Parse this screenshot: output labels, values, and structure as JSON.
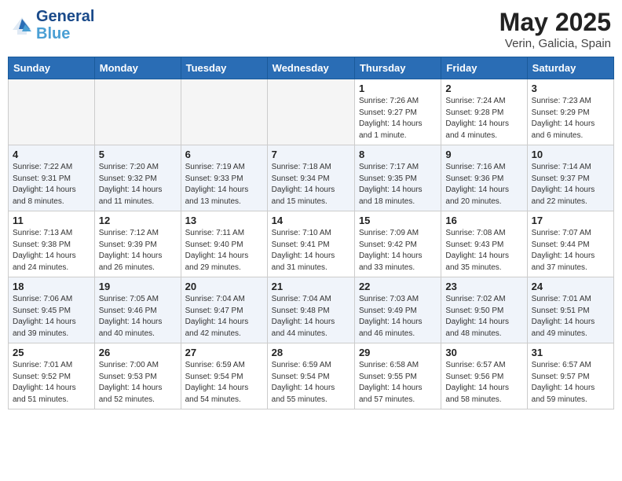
{
  "header": {
    "logo_line1": "General",
    "logo_line2": "Blue",
    "month_title": "May 2025",
    "location": "Verin, Galicia, Spain"
  },
  "days_of_week": [
    "Sunday",
    "Monday",
    "Tuesday",
    "Wednesday",
    "Thursday",
    "Friday",
    "Saturday"
  ],
  "weeks": [
    [
      {
        "num": "",
        "info": ""
      },
      {
        "num": "",
        "info": ""
      },
      {
        "num": "",
        "info": ""
      },
      {
        "num": "",
        "info": ""
      },
      {
        "num": "1",
        "info": "Sunrise: 7:26 AM\nSunset: 9:27 PM\nDaylight: 14 hours\nand 1 minute."
      },
      {
        "num": "2",
        "info": "Sunrise: 7:24 AM\nSunset: 9:28 PM\nDaylight: 14 hours\nand 4 minutes."
      },
      {
        "num": "3",
        "info": "Sunrise: 7:23 AM\nSunset: 9:29 PM\nDaylight: 14 hours\nand 6 minutes."
      }
    ],
    [
      {
        "num": "4",
        "info": "Sunrise: 7:22 AM\nSunset: 9:31 PM\nDaylight: 14 hours\nand 8 minutes."
      },
      {
        "num": "5",
        "info": "Sunrise: 7:20 AM\nSunset: 9:32 PM\nDaylight: 14 hours\nand 11 minutes."
      },
      {
        "num": "6",
        "info": "Sunrise: 7:19 AM\nSunset: 9:33 PM\nDaylight: 14 hours\nand 13 minutes."
      },
      {
        "num": "7",
        "info": "Sunrise: 7:18 AM\nSunset: 9:34 PM\nDaylight: 14 hours\nand 15 minutes."
      },
      {
        "num": "8",
        "info": "Sunrise: 7:17 AM\nSunset: 9:35 PM\nDaylight: 14 hours\nand 18 minutes."
      },
      {
        "num": "9",
        "info": "Sunrise: 7:16 AM\nSunset: 9:36 PM\nDaylight: 14 hours\nand 20 minutes."
      },
      {
        "num": "10",
        "info": "Sunrise: 7:14 AM\nSunset: 9:37 PM\nDaylight: 14 hours\nand 22 minutes."
      }
    ],
    [
      {
        "num": "11",
        "info": "Sunrise: 7:13 AM\nSunset: 9:38 PM\nDaylight: 14 hours\nand 24 minutes."
      },
      {
        "num": "12",
        "info": "Sunrise: 7:12 AM\nSunset: 9:39 PM\nDaylight: 14 hours\nand 26 minutes."
      },
      {
        "num": "13",
        "info": "Sunrise: 7:11 AM\nSunset: 9:40 PM\nDaylight: 14 hours\nand 29 minutes."
      },
      {
        "num": "14",
        "info": "Sunrise: 7:10 AM\nSunset: 9:41 PM\nDaylight: 14 hours\nand 31 minutes."
      },
      {
        "num": "15",
        "info": "Sunrise: 7:09 AM\nSunset: 9:42 PM\nDaylight: 14 hours\nand 33 minutes."
      },
      {
        "num": "16",
        "info": "Sunrise: 7:08 AM\nSunset: 9:43 PM\nDaylight: 14 hours\nand 35 minutes."
      },
      {
        "num": "17",
        "info": "Sunrise: 7:07 AM\nSunset: 9:44 PM\nDaylight: 14 hours\nand 37 minutes."
      }
    ],
    [
      {
        "num": "18",
        "info": "Sunrise: 7:06 AM\nSunset: 9:45 PM\nDaylight: 14 hours\nand 39 minutes."
      },
      {
        "num": "19",
        "info": "Sunrise: 7:05 AM\nSunset: 9:46 PM\nDaylight: 14 hours\nand 40 minutes."
      },
      {
        "num": "20",
        "info": "Sunrise: 7:04 AM\nSunset: 9:47 PM\nDaylight: 14 hours\nand 42 minutes."
      },
      {
        "num": "21",
        "info": "Sunrise: 7:04 AM\nSunset: 9:48 PM\nDaylight: 14 hours\nand 44 minutes."
      },
      {
        "num": "22",
        "info": "Sunrise: 7:03 AM\nSunset: 9:49 PM\nDaylight: 14 hours\nand 46 minutes."
      },
      {
        "num": "23",
        "info": "Sunrise: 7:02 AM\nSunset: 9:50 PM\nDaylight: 14 hours\nand 48 minutes."
      },
      {
        "num": "24",
        "info": "Sunrise: 7:01 AM\nSunset: 9:51 PM\nDaylight: 14 hours\nand 49 minutes."
      }
    ],
    [
      {
        "num": "25",
        "info": "Sunrise: 7:01 AM\nSunset: 9:52 PM\nDaylight: 14 hours\nand 51 minutes."
      },
      {
        "num": "26",
        "info": "Sunrise: 7:00 AM\nSunset: 9:53 PM\nDaylight: 14 hours\nand 52 minutes."
      },
      {
        "num": "27",
        "info": "Sunrise: 6:59 AM\nSunset: 9:54 PM\nDaylight: 14 hours\nand 54 minutes."
      },
      {
        "num": "28",
        "info": "Sunrise: 6:59 AM\nSunset: 9:54 PM\nDaylight: 14 hours\nand 55 minutes."
      },
      {
        "num": "29",
        "info": "Sunrise: 6:58 AM\nSunset: 9:55 PM\nDaylight: 14 hours\nand 57 minutes."
      },
      {
        "num": "30",
        "info": "Sunrise: 6:57 AM\nSunset: 9:56 PM\nDaylight: 14 hours\nand 58 minutes."
      },
      {
        "num": "31",
        "info": "Sunrise: 6:57 AM\nSunset: 9:57 PM\nDaylight: 14 hours\nand 59 minutes."
      }
    ]
  ]
}
